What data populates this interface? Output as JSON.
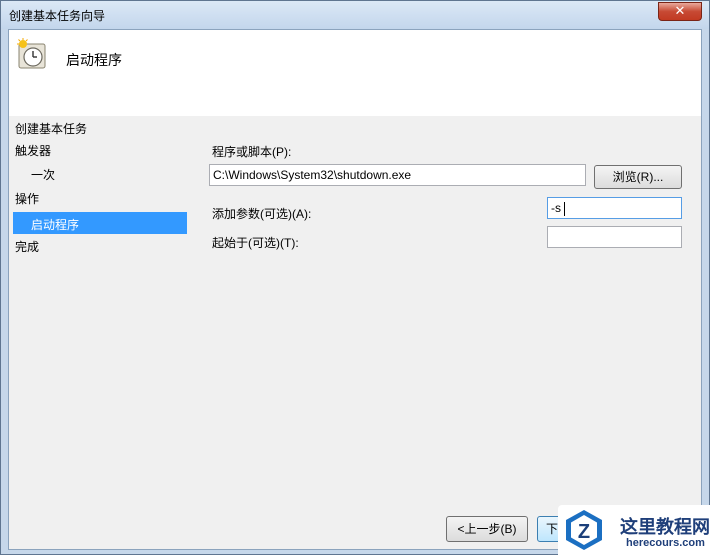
{
  "window": {
    "title": "创建基本任务向导",
    "close_label": "✕"
  },
  "header": {
    "title": "启动程序",
    "icon": "task-clock-icon"
  },
  "steps": {
    "heading": "创建基本任务",
    "items": [
      {
        "label": "触发器",
        "level": 0
      },
      {
        "label": "一次",
        "level": 1
      },
      {
        "label": "操作",
        "level": 0
      },
      {
        "label": "启动程序",
        "level": 1,
        "selected": true
      },
      {
        "label": "完成",
        "level": 0
      }
    ]
  },
  "form": {
    "program_label": "程序或脚本(P):",
    "program_value": "C:\\Windows\\System32\\shutdown.exe",
    "browse_label": "浏览(R)...",
    "args_label": "添加参数(可选)(A):",
    "args_value": "-s",
    "start_in_label": "起始于(可选)(T):",
    "start_in_value": ""
  },
  "footer": {
    "back_label": "<上一步(B)",
    "next_label_partial": "下"
  },
  "watermark": {
    "title": "这里教程网",
    "subtitle": "herecours.com",
    "logo_letter": "Z"
  },
  "colors": {
    "selection": "#3399ff",
    "client_bg": "#f0f0f0",
    "frame": "#c6d7ea"
  }
}
